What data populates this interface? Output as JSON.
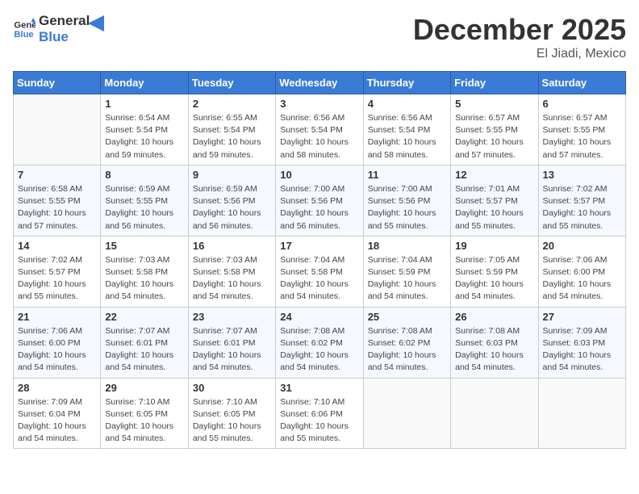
{
  "header": {
    "logo_line1": "General",
    "logo_line2": "Blue",
    "month": "December 2025",
    "location": "El Jiadi, Mexico"
  },
  "days_of_week": [
    "Sunday",
    "Monday",
    "Tuesday",
    "Wednesday",
    "Thursday",
    "Friday",
    "Saturday"
  ],
  "weeks": [
    [
      {
        "day": "",
        "info": ""
      },
      {
        "day": "1",
        "info": "Sunrise: 6:54 AM\nSunset: 5:54 PM\nDaylight: 10 hours\nand 59 minutes."
      },
      {
        "day": "2",
        "info": "Sunrise: 6:55 AM\nSunset: 5:54 PM\nDaylight: 10 hours\nand 59 minutes."
      },
      {
        "day": "3",
        "info": "Sunrise: 6:56 AM\nSunset: 5:54 PM\nDaylight: 10 hours\nand 58 minutes."
      },
      {
        "day": "4",
        "info": "Sunrise: 6:56 AM\nSunset: 5:54 PM\nDaylight: 10 hours\nand 58 minutes."
      },
      {
        "day": "5",
        "info": "Sunrise: 6:57 AM\nSunset: 5:55 PM\nDaylight: 10 hours\nand 57 minutes."
      },
      {
        "day": "6",
        "info": "Sunrise: 6:57 AM\nSunset: 5:55 PM\nDaylight: 10 hours\nand 57 minutes."
      }
    ],
    [
      {
        "day": "7",
        "info": "Sunrise: 6:58 AM\nSunset: 5:55 PM\nDaylight: 10 hours\nand 57 minutes."
      },
      {
        "day": "8",
        "info": "Sunrise: 6:59 AM\nSunset: 5:55 PM\nDaylight: 10 hours\nand 56 minutes."
      },
      {
        "day": "9",
        "info": "Sunrise: 6:59 AM\nSunset: 5:56 PM\nDaylight: 10 hours\nand 56 minutes."
      },
      {
        "day": "10",
        "info": "Sunrise: 7:00 AM\nSunset: 5:56 PM\nDaylight: 10 hours\nand 56 minutes."
      },
      {
        "day": "11",
        "info": "Sunrise: 7:00 AM\nSunset: 5:56 PM\nDaylight: 10 hours\nand 55 minutes."
      },
      {
        "day": "12",
        "info": "Sunrise: 7:01 AM\nSunset: 5:57 PM\nDaylight: 10 hours\nand 55 minutes."
      },
      {
        "day": "13",
        "info": "Sunrise: 7:02 AM\nSunset: 5:57 PM\nDaylight: 10 hours\nand 55 minutes."
      }
    ],
    [
      {
        "day": "14",
        "info": "Sunrise: 7:02 AM\nSunset: 5:57 PM\nDaylight: 10 hours\nand 55 minutes."
      },
      {
        "day": "15",
        "info": "Sunrise: 7:03 AM\nSunset: 5:58 PM\nDaylight: 10 hours\nand 54 minutes."
      },
      {
        "day": "16",
        "info": "Sunrise: 7:03 AM\nSunset: 5:58 PM\nDaylight: 10 hours\nand 54 minutes."
      },
      {
        "day": "17",
        "info": "Sunrise: 7:04 AM\nSunset: 5:58 PM\nDaylight: 10 hours\nand 54 minutes."
      },
      {
        "day": "18",
        "info": "Sunrise: 7:04 AM\nSunset: 5:59 PM\nDaylight: 10 hours\nand 54 minutes."
      },
      {
        "day": "19",
        "info": "Sunrise: 7:05 AM\nSunset: 5:59 PM\nDaylight: 10 hours\nand 54 minutes."
      },
      {
        "day": "20",
        "info": "Sunrise: 7:06 AM\nSunset: 6:00 PM\nDaylight: 10 hours\nand 54 minutes."
      }
    ],
    [
      {
        "day": "21",
        "info": "Sunrise: 7:06 AM\nSunset: 6:00 PM\nDaylight: 10 hours\nand 54 minutes."
      },
      {
        "day": "22",
        "info": "Sunrise: 7:07 AM\nSunset: 6:01 PM\nDaylight: 10 hours\nand 54 minutes."
      },
      {
        "day": "23",
        "info": "Sunrise: 7:07 AM\nSunset: 6:01 PM\nDaylight: 10 hours\nand 54 minutes."
      },
      {
        "day": "24",
        "info": "Sunrise: 7:08 AM\nSunset: 6:02 PM\nDaylight: 10 hours\nand 54 minutes."
      },
      {
        "day": "25",
        "info": "Sunrise: 7:08 AM\nSunset: 6:02 PM\nDaylight: 10 hours\nand 54 minutes."
      },
      {
        "day": "26",
        "info": "Sunrise: 7:08 AM\nSunset: 6:03 PM\nDaylight: 10 hours\nand 54 minutes."
      },
      {
        "day": "27",
        "info": "Sunrise: 7:09 AM\nSunset: 6:03 PM\nDaylight: 10 hours\nand 54 minutes."
      }
    ],
    [
      {
        "day": "28",
        "info": "Sunrise: 7:09 AM\nSunset: 6:04 PM\nDaylight: 10 hours\nand 54 minutes."
      },
      {
        "day": "29",
        "info": "Sunrise: 7:10 AM\nSunset: 6:05 PM\nDaylight: 10 hours\nand 54 minutes."
      },
      {
        "day": "30",
        "info": "Sunrise: 7:10 AM\nSunset: 6:05 PM\nDaylight: 10 hours\nand 55 minutes."
      },
      {
        "day": "31",
        "info": "Sunrise: 7:10 AM\nSunset: 6:06 PM\nDaylight: 10 hours\nand 55 minutes."
      },
      {
        "day": "",
        "info": ""
      },
      {
        "day": "",
        "info": ""
      },
      {
        "day": "",
        "info": ""
      }
    ]
  ]
}
